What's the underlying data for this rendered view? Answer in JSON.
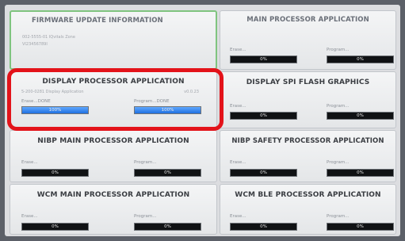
{
  "firmware_info": {
    "title": "FIRMWARE UPDATE INFORMATION",
    "line1": "002-5555-01 IQvitals Zone",
    "line2": "VI23456789I"
  },
  "panels": [
    {
      "title": "MAIN PROCESSOR APPLICATION",
      "subtitle": "",
      "version": "",
      "erase_label": "Erase...",
      "program_label": "Program...",
      "erase_pct": "0%",
      "program_pct": "0%",
      "erase_progress": 0,
      "program_progress": 0
    },
    {
      "title": "DISPLAY PROCESSOR APPLICATION",
      "subtitle": "5-200-0281 Display Application",
      "version": "v0.0.23",
      "erase_label": "Erase...DONE",
      "program_label": "Program...DONE",
      "erase_pct": "100%",
      "program_pct": "100%",
      "erase_progress": 1,
      "program_progress": 1
    },
    {
      "title": "DISPLAY SPI FLASH GRAPHICS",
      "subtitle": "",
      "version": "",
      "erase_label": "Erase...",
      "program_label": "Program...",
      "erase_pct": "0%",
      "program_pct": "0%",
      "erase_progress": 0,
      "program_progress": 0
    },
    {
      "title": "NIBP MAIN PROCESSOR APPLICATION",
      "subtitle": "",
      "version": "",
      "erase_label": "Erase...",
      "program_label": "Program...",
      "erase_pct": "0%",
      "program_pct": "0%",
      "erase_progress": 0,
      "program_progress": 0
    },
    {
      "title": "NIBP SAFETY PROCESSOR APPLICATION",
      "subtitle": "",
      "version": "",
      "erase_label": "Erase...",
      "program_label": "Program...",
      "erase_pct": "0%",
      "program_pct": "0%",
      "erase_progress": 0,
      "program_progress": 0
    },
    {
      "title": "WCM MAIN PROCESSOR APPLICATION",
      "subtitle": "",
      "version": "",
      "erase_label": "Erase...",
      "program_label": "Program...",
      "erase_pct": "0%",
      "program_pct": "0%",
      "erase_progress": 0,
      "program_progress": 0
    },
    {
      "title": "WCM BLE PROCESSOR APPLICATION",
      "subtitle": "",
      "version": "",
      "erase_label": "Erase...",
      "program_label": "Program...",
      "erase_pct": "0%",
      "program_pct": "0%",
      "erase_progress": 0,
      "program_progress": 0
    }
  ],
  "colors": {
    "highlight": "#e3131a",
    "progress_fill": "#1f6fe0",
    "active_border": "#7fc47f"
  }
}
